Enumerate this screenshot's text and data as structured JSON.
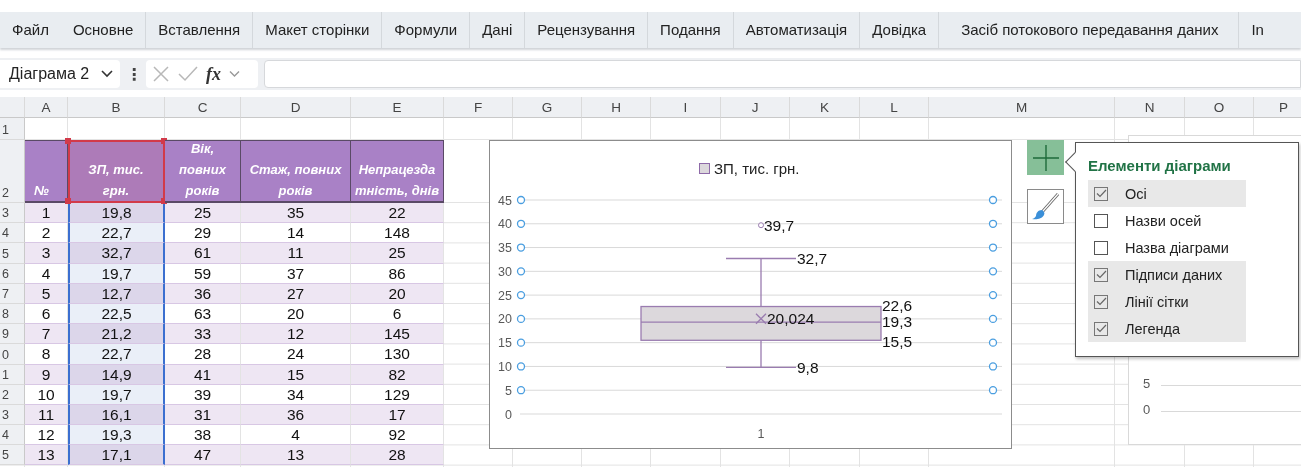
{
  "ribbon": {
    "tabs": [
      "Файл",
      "Основне",
      "Вставлення",
      "Макет сторінки",
      "Формули",
      "Дані",
      "Рецензування",
      "Подання",
      "Автоматизація",
      "Довідка",
      "Засіб потокового передавання даних",
      "In"
    ]
  },
  "formula_bar": {
    "name_box": "Діаграма 2",
    "more_label": "⋮",
    "function_label": "fx"
  },
  "sheet": {
    "columns": [
      "A",
      "B",
      "C",
      "D",
      "E",
      "F",
      "G",
      "H",
      "I",
      "J",
      "K",
      "L",
      "M",
      "N",
      "O",
      "P"
    ],
    "row_numbers": [
      "1",
      "2",
      "3",
      "4",
      "5",
      "6",
      "7",
      "8",
      "9",
      "0",
      "1",
      "2",
      "3",
      "4",
      "5"
    ],
    "table": {
      "headers": [
        {
          "text": "№",
          "selected": false,
          "in_chart_range": false
        },
        {
          "text": "ЗП, тис. грн.",
          "selected": true,
          "in_chart_range": true
        },
        {
          "text": "Вік, повних років",
          "selected": false,
          "in_chart_range": false
        },
        {
          "text": "Стаж, повних років",
          "selected": false,
          "in_chart_range": false
        },
        {
          "text": "Непрацездатність, днів",
          "selected": false,
          "in_chart_range": false
        }
      ],
      "rows": [
        [
          "1",
          "19,8",
          "25",
          "35",
          "22"
        ],
        [
          "2",
          "22,7",
          "29",
          "14",
          "148"
        ],
        [
          "3",
          "32,7",
          "61",
          "11",
          "25"
        ],
        [
          "4",
          "19,7",
          "59",
          "37",
          "86"
        ],
        [
          "5",
          "12,7",
          "36",
          "27",
          "20"
        ],
        [
          "6",
          "22,5",
          "63",
          "20",
          "6"
        ],
        [
          "7",
          "21,2",
          "33",
          "12",
          "145"
        ],
        [
          "8",
          "22,7",
          "28",
          "24",
          "130"
        ],
        [
          "9",
          "14,9",
          "41",
          "15",
          "82"
        ],
        [
          "10",
          "19,7",
          "39",
          "34",
          "129"
        ],
        [
          "11",
          "16,1",
          "31",
          "36",
          "17"
        ],
        [
          "12",
          "19,3",
          "38",
          "4",
          "92"
        ],
        [
          "13",
          "17,1",
          "47",
          "13",
          "28"
        ]
      ]
    }
  },
  "chart": {
    "selected": true,
    "chart_data": {
      "type": "box",
      "categories": [
        "1"
      ],
      "ylim": [
        0,
        45
      ],
      "yticks": [
        0,
        5,
        10,
        15,
        20,
        25,
        30,
        35,
        40,
        45
      ],
      "grid": true,
      "series": [
        {
          "name": "ЗП, тис. грн.",
          "color": "#dcd8dc",
          "values": [
            null
          ]
        }
      ],
      "annotations": [
        "39,7",
        "32,7",
        "22,6",
        "19,3",
        "15,5",
        "9,8",
        "20,024"
      ]
    }
  },
  "chart_buttons": [
    {
      "kind": "elements",
      "active": true
    },
    {
      "kind": "styles",
      "active": false
    }
  ],
  "chart_elements_popup": {
    "title": "Елементи діаграми",
    "items": [
      {
        "label": "Осі",
        "checked": true
      },
      {
        "label": "Назви осей",
        "checked": false
      },
      {
        "label": "Назва діаграми",
        "checked": false
      },
      {
        "label": "Підписи даних",
        "checked": true
      },
      {
        "label": "Лінії сітки",
        "checked": true
      },
      {
        "label": "Легенда",
        "checked": true
      }
    ]
  },
  "background_chart": {
    "axis_labels": [
      "5",
      "0"
    ]
  }
}
